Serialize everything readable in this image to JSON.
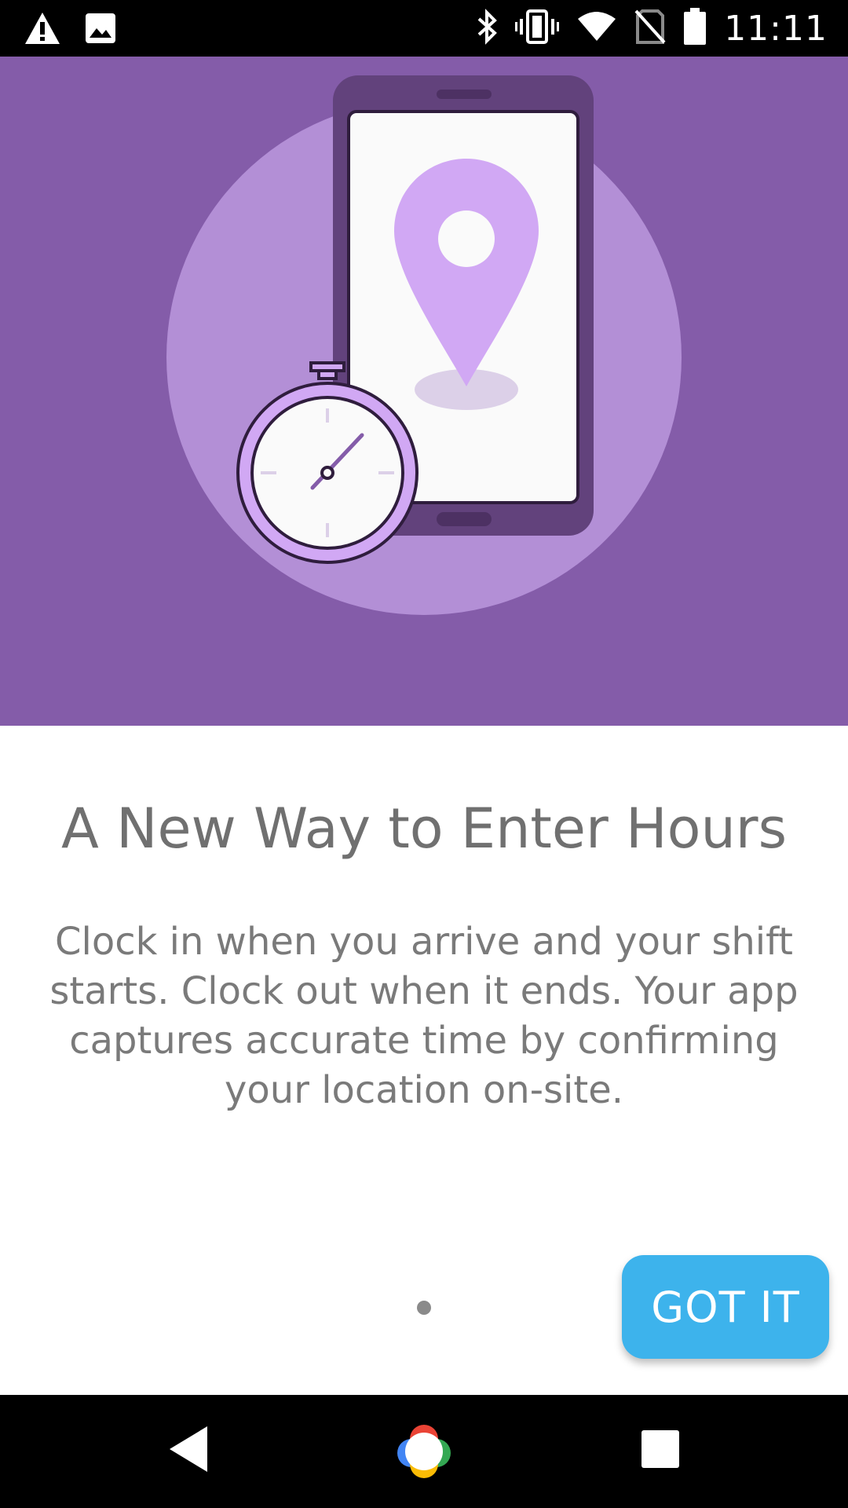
{
  "status_bar": {
    "time": "11:11",
    "icons_left": [
      "warning-icon",
      "image-icon"
    ],
    "icons_right": [
      "bluetooth-icon",
      "vibrate-icon",
      "wifi-icon",
      "no-sim-icon",
      "battery-icon"
    ]
  },
  "hero": {
    "illustration": [
      "circle-backdrop",
      "phone-icon",
      "location-pin-icon",
      "stopwatch-icon"
    ],
    "colors": {
      "background": "#845ca9",
      "circle": "#b38fd6",
      "pin": "#d1a8f4"
    }
  },
  "onboarding": {
    "title": "A New Way to Enter Hours",
    "body": "Clock in when you arrive and your shift starts. Clock out when it ends. Your app captures accurate time by confirming your location on-site.",
    "page_indicator": {
      "current": 1,
      "total": 1
    },
    "got_it_label": "GOT IT"
  },
  "nav_bar": {
    "buttons": [
      "back-icon",
      "home-icon",
      "recents-icon"
    ]
  },
  "colors": {
    "accent": "#3db3ec",
    "text": "#707070"
  }
}
